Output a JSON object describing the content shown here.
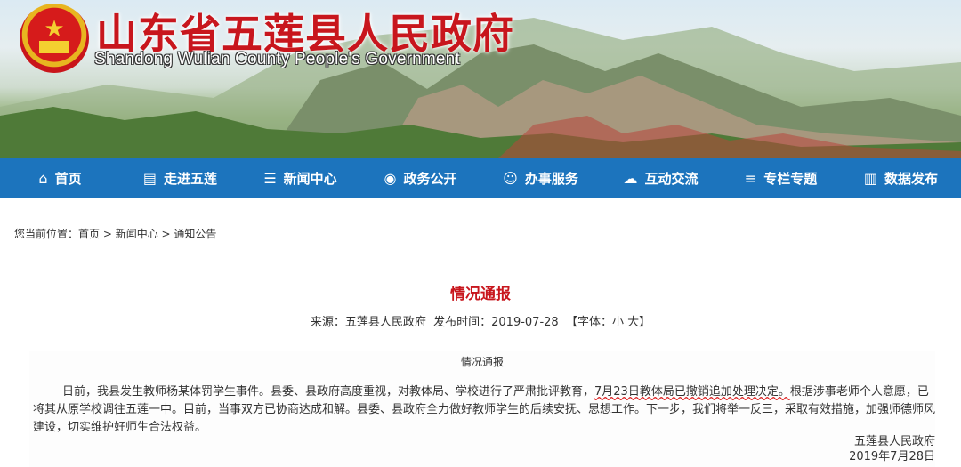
{
  "site": {
    "title_cn": "山东省五莲县人民政府",
    "title_en": "Shandong Wulian County People's Government"
  },
  "nav": [
    {
      "label": "首页",
      "icon": "home-icon"
    },
    {
      "label": "走进五莲",
      "icon": "document-icon"
    },
    {
      "label": "新闻中心",
      "icon": "news-icon"
    },
    {
      "label": "政务公开",
      "icon": "eye-icon"
    },
    {
      "label": "办事服务",
      "icon": "smile-icon"
    },
    {
      "label": "互动交流",
      "icon": "cloud-icon"
    },
    {
      "label": "专栏专题",
      "icon": "list-icon"
    },
    {
      "label": "数据发布",
      "icon": "chart-icon"
    }
  ],
  "breadcrumb": {
    "prefix": "您当前位置：",
    "items": [
      "首页",
      "新闻中心",
      "通知公告"
    ],
    "sep": " > "
  },
  "article": {
    "title": "情况通报",
    "source_label": "来源：",
    "source": "五莲县人民政府",
    "date_label": "发布时间：",
    "date": "2019-07-28",
    "font_label": "【字体：",
    "font_small": "小",
    "font_large": "大",
    "font_close": "】",
    "notice_heading": "情况通报",
    "body_part1": "日前，我县发生教师杨某体罚学生事件。县委、县政府高度重视，对教体局、学校进行了严肃批评教育，",
    "body_highlight": "7月23日教体局已撤销追加处理决定。",
    "body_part2": "根据涉事老师个人意愿，已将其从原学校调往五莲一中。目前，当事双方已协商达成和解。县委、县政府全力做好教师学生的后续安抚、思想工作。下一步，我们将举一反三，采取有效措施，加强师德师风建设，切实维护好师生合法权益。",
    "signature": "五莲县人民政府",
    "sign_date": "2019年7月28日"
  },
  "colors": {
    "nav_bg": "#1c74bd",
    "title_red": "#c8161d"
  }
}
